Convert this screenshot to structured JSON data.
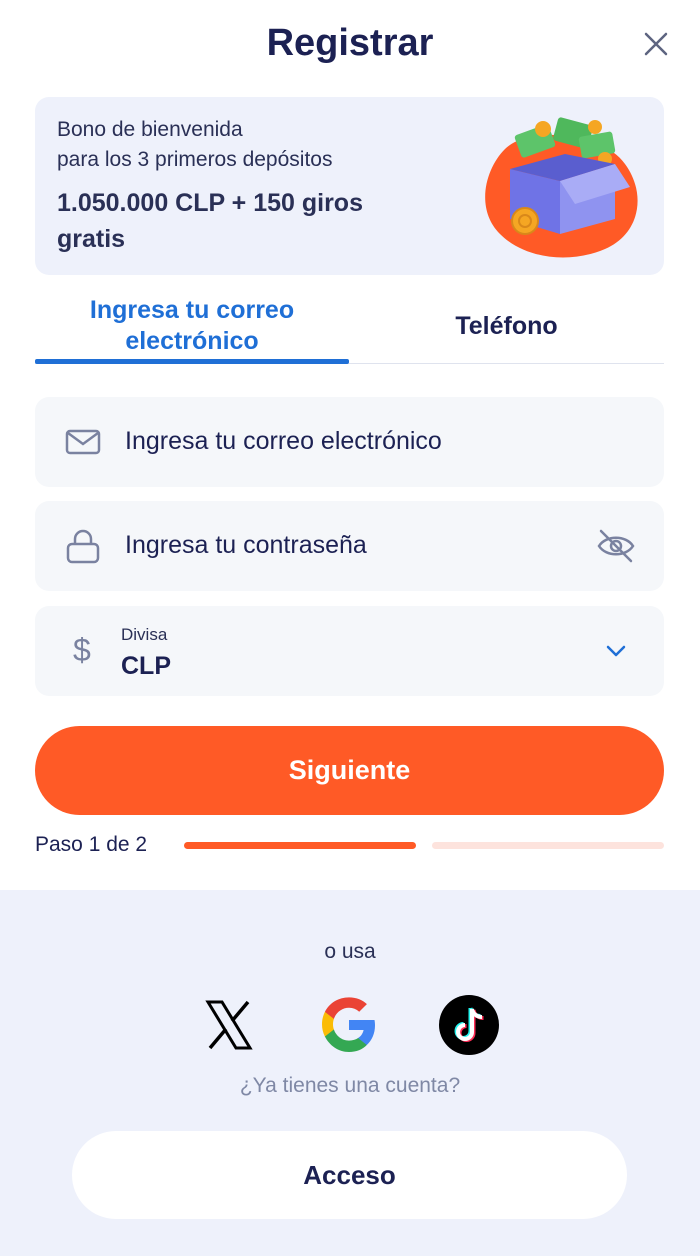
{
  "header": {
    "title": "Registrar",
    "close_icon": "close-icon"
  },
  "bonus": {
    "line1": "Bono de bienvenida",
    "line2": "para los 3 primeros depósitos",
    "amount": "1.050.000 CLP + 150 giros gratis"
  },
  "tabs": [
    {
      "label": "Ingresa tu correo electrónico",
      "active": true
    },
    {
      "label": "Teléfono",
      "active": false
    }
  ],
  "form": {
    "email_placeholder": "Ingresa tu correo electrónico",
    "password_placeholder": "Ingresa tu contraseña",
    "currency_label": "Divisa",
    "currency_value": "CLP",
    "currency_symbol": "$"
  },
  "next_button": "Siguiente",
  "step": {
    "text": "Paso 1 de 2",
    "current": 1,
    "total": 2
  },
  "footer": {
    "or_use": "o usa",
    "social": [
      "x-icon",
      "google-icon",
      "tiktok-icon"
    ],
    "have_account": "¿Ya tienes una cuenta?",
    "login_button": "Acceso"
  },
  "colors": {
    "accent": "#ff5a26",
    "tab_active": "#1f6fd6",
    "text": "#1c2153",
    "card_bg": "#eef1fb"
  }
}
